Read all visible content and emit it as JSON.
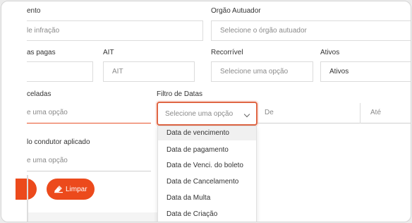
{
  "labels": {
    "vencimento": "ento",
    "orgao": "Orgão Autuador",
    "pagas": "as pagas",
    "ait": "AIT",
    "recorrivel": "Recorrível",
    "ativos": "Ativos",
    "canceladas": "celadas",
    "filtro_datas": "Filtro de Datas",
    "condutor": "lo condutor aplicado"
  },
  "fields": {
    "infracao": "le infração",
    "orgao_placeholder": "Selecione o órgão autuador",
    "ait_placeholder": "AIT",
    "recorrivel_placeholder": "Selecione uma opção",
    "ativos_value": "Ativos",
    "canceladas_placeholder": "e uma opção",
    "filtro_placeholder": "Selecione uma opção",
    "de": "De",
    "ate": "Até",
    "condutor_placeholder": "e uma opção"
  },
  "dropdown": {
    "options": [
      "Data de vencimento",
      "Data de pagamento",
      "Data de Venci. do boleto",
      "Data de Cancelamento",
      "Data da Multa",
      "Data de Criação"
    ]
  },
  "buttons": {
    "limpar": "Limpar"
  },
  "colors": {
    "accent": "#ec4a1c",
    "focus_border": "#e06644"
  }
}
